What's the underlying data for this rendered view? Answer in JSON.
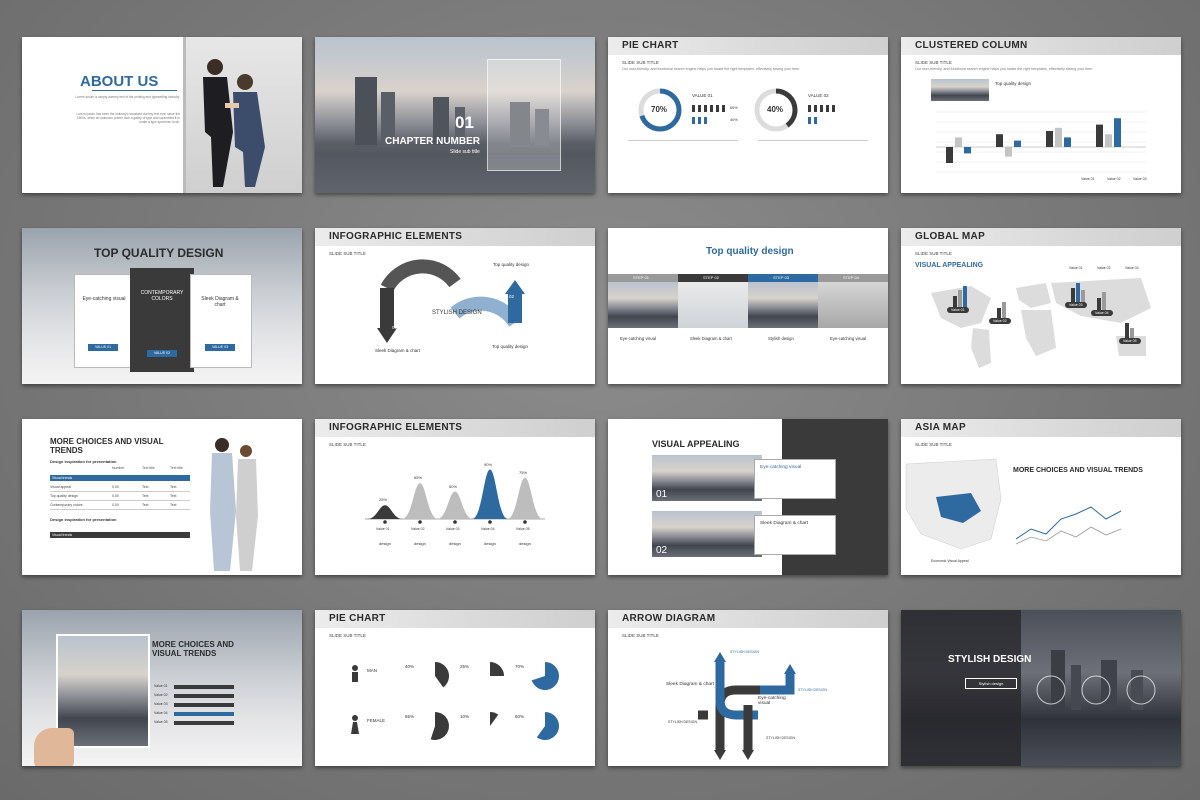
{
  "slides": {
    "s1": {
      "title": "ABOUT US",
      "text1": "Lorem Ipsum is simply dummy text of the printing and typesetting industry.",
      "text2": "Lorem Ipsum has been the industry's standard dummy text ever since the 1500s, when an unknown printer took a galley of type and scrambled it to make a type specimen book."
    },
    "s2": {
      "number": "01",
      "title": "CHAPTER NUMBER",
      "subtitle": "Slide sub title"
    },
    "s3": {
      "title": "PIE CHART",
      "sub": "SLIDE SUB TITLE",
      "subtxt": "Our user-friendly, and functional search engine helps you locate the right templates, effectively saving your time.",
      "pie1": {
        "pct": "70%",
        "label": "VALUE 01",
        "value": 70
      },
      "pie2": {
        "pct": "40%",
        "label": "VALUE 02",
        "value": 40
      },
      "legend": [
        "60%",
        "40%"
      ]
    },
    "s4": {
      "title": "CLUSTERED COLUMN",
      "sub": "SLIDE SUB TITLE",
      "subtxt": "Our user-friendly, and functional search engine helps you locate the right templates, effectively saving your time.",
      "caption": "Top quality design",
      "legend": [
        "Value 01",
        "Value 02",
        "Value 03"
      ]
    },
    "s5": {
      "title": "TOP QUALITY DESIGN",
      "cards": [
        {
          "title": "Eye-catching visual",
          "btn": "VALUE 01"
        },
        {
          "title": "CONTEMPORARY COLORS",
          "btn": "VALUE 02"
        },
        {
          "title": "Sleek Diagram & chart",
          "btn": "VALUE 03"
        }
      ]
    },
    "s6": {
      "title": "INFOGRAPHIC ELEMENTS",
      "sub": "SLIDE SUB TITLE",
      "center": "STYLISH DESIGN",
      "top": "Top quality design",
      "left": "Sleek Diagram & chart",
      "bottom": "Top quality design",
      "n1": "01",
      "n2": "02"
    },
    "s7": {
      "title": "Top quality design",
      "steps": [
        "STEP 01",
        "STEP 02",
        "STEP 03",
        "STEP 04"
      ],
      "caps": [
        "Eye-catching visual",
        "Sleek Diagram & chart",
        "Stylish design",
        "Eye-catching visual"
      ]
    },
    "s8": {
      "title": "GLOBAL MAP",
      "sub": "SLIDE SUB TITLE",
      "heading": "VISUAL APPEALING",
      "legend": [
        "Value 01",
        "Value 02",
        "Value 03"
      ],
      "tags": [
        "Value 01",
        "Value 02",
        "Value 03",
        "Value 04",
        "Value 05"
      ]
    },
    "s9": {
      "title": "MORE CHOICES AND VISUAL TRENDS",
      "t1": "Design inspiration for presentation",
      "cols": [
        "Number",
        "Text title",
        "Text title"
      ],
      "rowhead": "Visual trends",
      "rows": [
        [
          "Visual appeal",
          "0.00",
          "Text",
          "Text"
        ],
        [
          "Top quality design",
          "0.00",
          "Text",
          "Text"
        ],
        [
          "Contemporary colors",
          "0.00",
          "Text",
          "Text"
        ]
      ],
      "t2": "Design inspiration for presentation"
    },
    "s10": {
      "title": "INFOGRAPHIC ELEMENTS",
      "sub": "SLIDE SUB TITLE",
      "pcts": [
        "25%",
        "65%",
        "50%",
        "90%",
        "75%"
      ],
      "labels": [
        "Value 01",
        "Value 02",
        "Value 03",
        "Value 04",
        "Value 05"
      ],
      "word": "design"
    },
    "s11": {
      "title": "VISUAL APPEALING",
      "c1": "Eye-catching visual",
      "c2": "Sleek Diagram & chart",
      "n1": "01",
      "n2": "02"
    },
    "s12": {
      "title": "ASIA MAP",
      "sub": "SLIDE SUB TITLE",
      "heading": "MORE CHOICES AND VISUAL TRENDS",
      "caption": "Economic Visual Appeal"
    },
    "s13": {
      "title": "MORE CHOICES AND VISUAL TRENDS",
      "rows": [
        "Value 01",
        "Value 02",
        "Value 03",
        "Value 04",
        "Value 05"
      ]
    },
    "s14": {
      "title": "PIE CHART",
      "sub": "SLIDE SUB TITLE",
      "man": "MAN",
      "female": "FEMALE",
      "pies": [
        {
          "pct": "40%",
          "value": 40
        },
        {
          "pct": "25%",
          "value": 25
        },
        {
          "pct": "70%",
          "value": 70
        },
        {
          "pct": "55%",
          "value": 55
        },
        {
          "pct": "10%",
          "value": 10
        },
        {
          "pct": "60%",
          "value": 60
        }
      ]
    },
    "s15": {
      "title": "ARROW DIAGRAM",
      "sub": "SLIDE SUB TITLE",
      "left": "Sleek Diagram & chart",
      "right": "Eye-catching visual",
      "s1": "STYLISH DESIGN",
      "s2": "STYLISH DESIGN",
      "s3": "STYLISH DESIGN",
      "s4": "STYLISH DESIGN"
    },
    "s16": {
      "title": "STYLISH DESIGN",
      "btn": "Stylish design"
    }
  },
  "colors": {
    "accent": "#2e6aa0",
    "dark": "#3a3a3a",
    "grey": "#9a9a9a"
  }
}
